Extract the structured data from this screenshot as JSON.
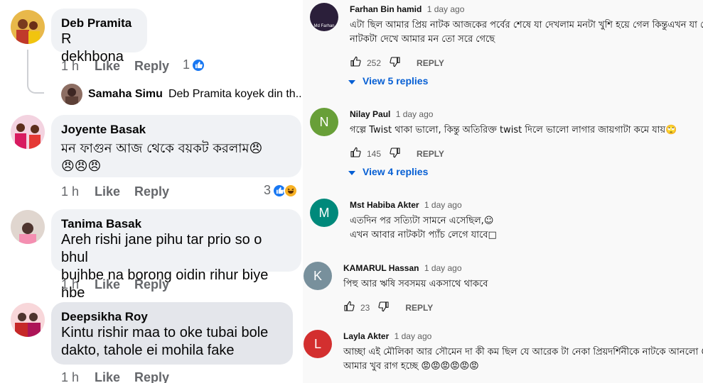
{
  "fb": {
    "comments": [
      {
        "name": "Deb Pramita",
        "text_lines": [
          "R dekhbona"
        ],
        "time": "1 h",
        "like": "Like",
        "reply": "Reply",
        "reaction_count": "1",
        "reply_preview": {
          "name": "Samaha Simu",
          "text": "Deb Pramita koyek din th..."
        }
      },
      {
        "name": "Joyente Basak",
        "text_lines": [
          "মন ফাগুন আজ থেকে বয়কট করলাম😠",
          "😠😠😠"
        ],
        "time": "1 h",
        "like": "Like",
        "reply": "Reply",
        "reaction_count": "3"
      },
      {
        "name": "Tanima Basak",
        "text_lines": [
          "Areh rishi jane pihu tar prio so o bhul",
          "bujhbe na borong oidin rihur biye hbe"
        ],
        "time": "1 h",
        "like": "Like",
        "reply": "Reply"
      },
      {
        "name": "Deepsikha Roy",
        "text_lines": [
          "Kintu rishir maa to oke tubai bole",
          "dakto, tahole ei mohila fake"
        ],
        "time": "1 h",
        "like": "Like",
        "reply": "Reply"
      }
    ]
  },
  "yt": {
    "comments": [
      {
        "author": "Farhan Bin hamid",
        "time": "1 day ago",
        "avatar_text": "Md Farhan",
        "avatar_color": "#2b1f3a",
        "text_lines": [
          "এটা ছিল আমার প্রিয় নাটক আজকের পর্বের শেষে   যা দেখলাম মনটা খুশি হয়ে গেল   কিন্তুএখন যা দে",
          "নাটকটা দেখে আমার মন তো সরে গেছে"
        ],
        "likes": "252",
        "reply_label": "REPLY",
        "view_replies": "View 5 replies"
      },
      {
        "author": "Nilay Paul",
        "time": "1 day ago",
        "avatar_text": "N",
        "avatar_color": "#689f38",
        "text_lines": [
          "গল্পে Twist থাকা ভালো, কিন্তু অতিরিক্ত twist দিলে ভালো লাগার জায়গাটা কমে যায়🙄"
        ],
        "likes": "145",
        "reply_label": "REPLY",
        "view_replies": "View 4 replies"
      },
      {
        "author": "Mst Habiba Akter",
        "time": "1 day ago",
        "avatar_text": "M",
        "avatar_color": "#00897b",
        "text_lines": [
          "এতদিন পর সত্যিটা সামনে এসেছিল,☺",
          "এখন আবার নাটকটা প্যাঁচ লেগে যাবে□"
        ]
      },
      {
        "author": "KAMARUL Hassan",
        "time": "1 day ago",
        "avatar_text": "K",
        "avatar_color": "#78909c",
        "text_lines": [
          "পিহু আর ঋষি সবসময় একসাথে থাকবে"
        ],
        "likes": "23",
        "reply_label": "REPLY"
      },
      {
        "author": "Layla Akter",
        "time": "1 day ago",
        "avatar_text": "L",
        "avatar_color": "#d32f2f",
        "text_lines": [
          "আচ্ছা এই মৌলিকা আর সৌমেন দা  কী কম ছিল যে আরেক টা নেকা প্রিয়দর্শিনীকে নাটকে আনলো ☺☺",
          "আমার খুব রাগ হচ্ছে 😡😡😡😡😡😡"
        ]
      }
    ]
  },
  "colors": {
    "fb_blue": "#1877f2",
    "yt_link": "#065fd4"
  }
}
